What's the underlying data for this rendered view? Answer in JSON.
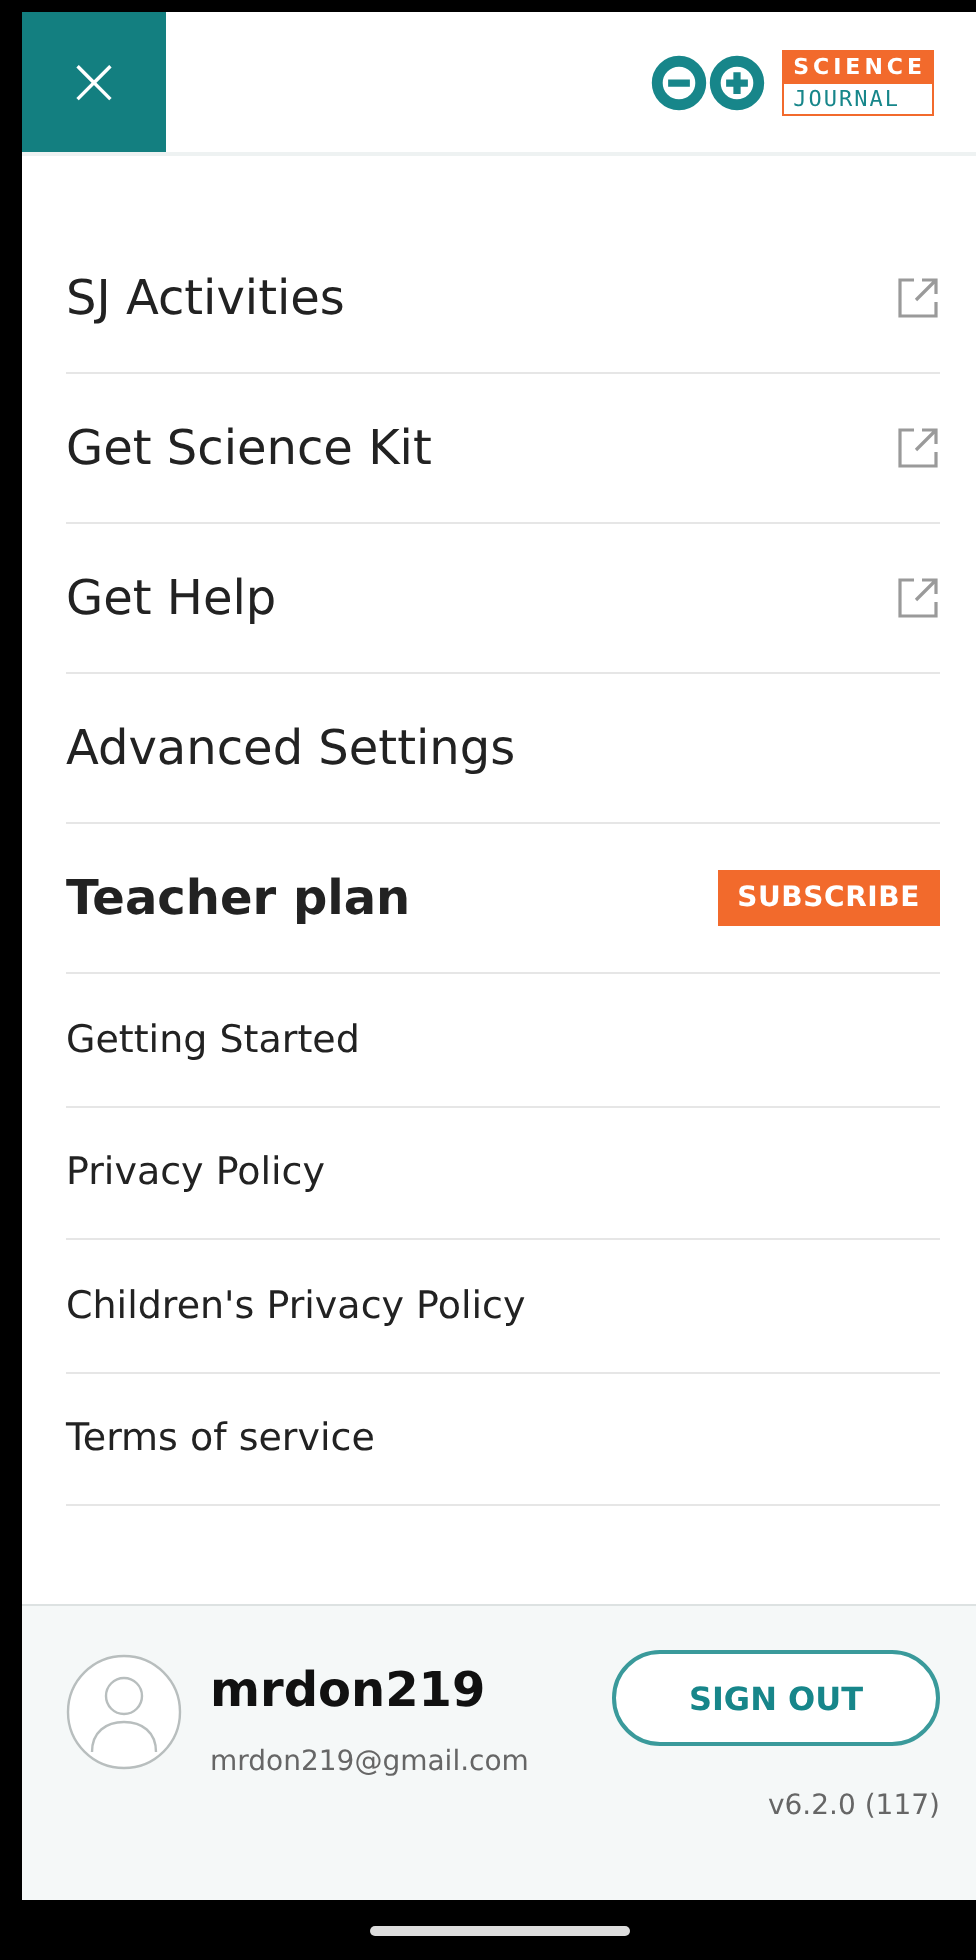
{
  "header": {
    "close_icon": "×",
    "logo": {
      "top": "SCIENCE",
      "bottom": "JOURNAL"
    }
  },
  "main_items": [
    {
      "label": "SJ Activities",
      "kind": "external"
    },
    {
      "label": "Get Science Kit",
      "kind": "external"
    },
    {
      "label": "Get Help",
      "kind": "external"
    },
    {
      "label": "Advanced Settings",
      "kind": "plain"
    },
    {
      "label": "Teacher plan",
      "kind": "plan",
      "badge": "SUBSCRIBE"
    }
  ],
  "secondary_items": [
    "Getting Started",
    "Privacy Policy",
    "Children's Privacy Policy",
    "Terms of service"
  ],
  "account": {
    "username": "mrdon219",
    "email": "mrdon219@gmail.com",
    "button": "SIGN OUT",
    "version": "v6.2.0 (117)"
  }
}
